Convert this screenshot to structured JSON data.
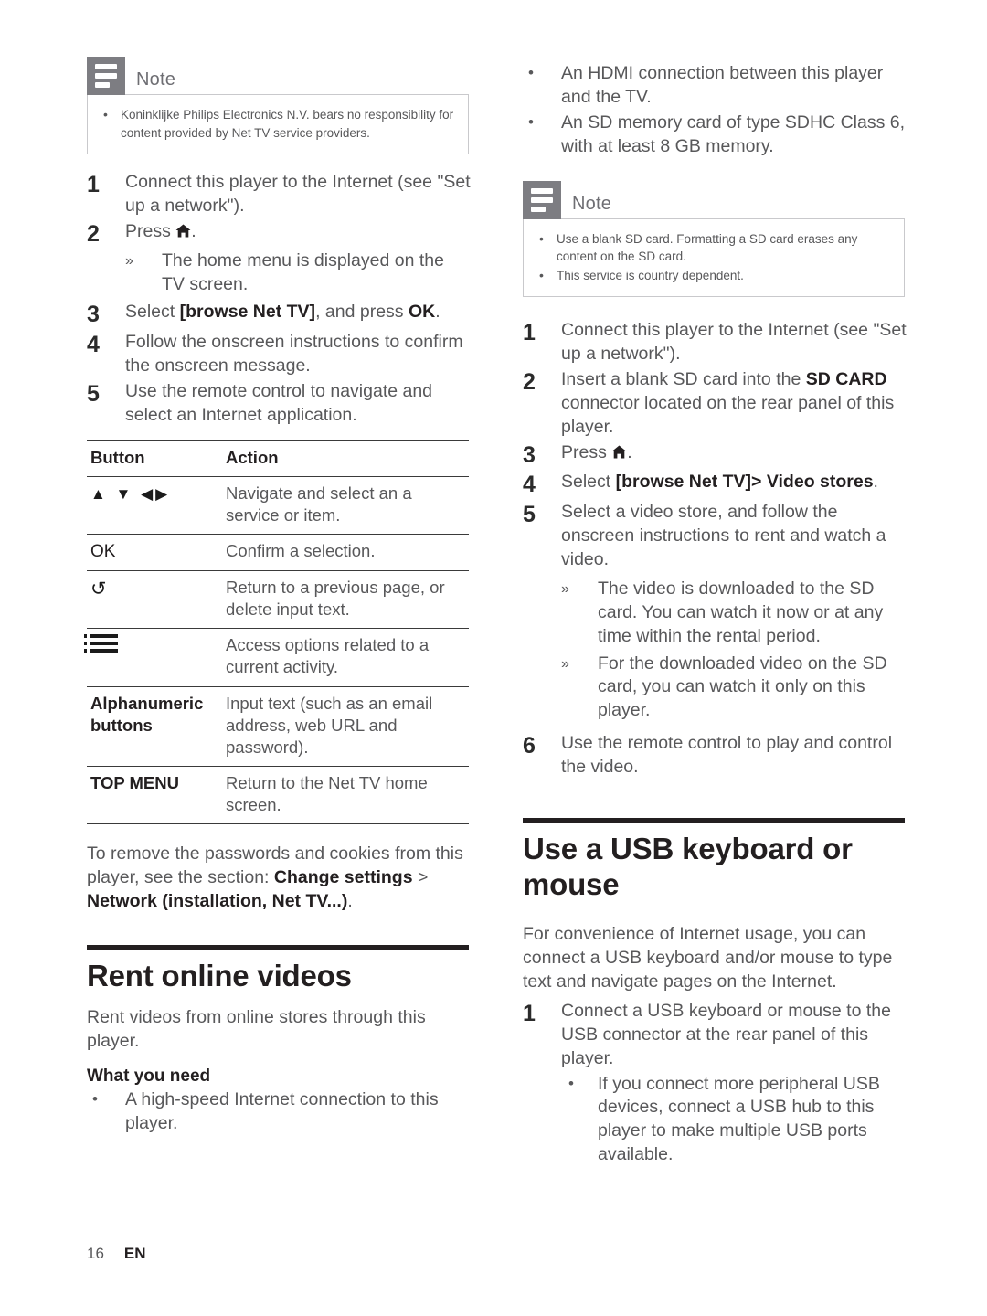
{
  "page": {
    "number": "16",
    "language": "EN"
  },
  "colors": {
    "note_icon_bg": "#7d7d82",
    "note_border": "#c9c9cc",
    "heading": "#231f20",
    "body_text": "#58585a"
  },
  "left_column": {
    "note": {
      "icon_name": "note-icon",
      "title": "Note",
      "items": [
        "Koninklijke Philips Electronics N.V. bears no responsibility for content provided by Net TV service providers."
      ]
    },
    "steps": [
      {
        "num": "1",
        "text": "Connect this player to the Internet (see \"Set up a network\")."
      },
      {
        "num": "2",
        "text": "Press ⌂.",
        "text_plain": "Press .",
        "subs": [
          "The home menu is displayed on the TV screen."
        ]
      },
      {
        "num": "3",
        "text": "Select [browse Net TV], and press OK."
      },
      {
        "num": "4",
        "text": "Follow the onscreen instructions to confirm the onscreen message."
      },
      {
        "num": "5",
        "text": "Use the remote control to navigate and select an Internet application."
      }
    ],
    "table": {
      "headers": [
        "Button",
        "Action"
      ],
      "rows": [
        {
          "button": "▲ ▼ ◀▶",
          "button_kind": "arrows",
          "action": "Navigate and select an a service or item."
        },
        {
          "button": "OK",
          "button_kind": "text",
          "action": "Confirm a selection."
        },
        {
          "button": "↺",
          "button_kind": "return",
          "action": "Return to a previous page, or delete input text."
        },
        {
          "button": "options-list-icon",
          "button_kind": "icon",
          "action": "Access options related to a current activity."
        },
        {
          "button": "Alphanumeric buttons",
          "button_kind": "bold",
          "action": "Input text (such as an email address, web URL and password)."
        },
        {
          "button": "TOP MENU",
          "button_kind": "bold",
          "action": "Return to the Net TV home screen."
        }
      ]
    },
    "closing_paragraph": {
      "lead": "To remove the passwords and cookies from this player, see the section: ",
      "bold1": "Change settings",
      "mid": " > ",
      "bold2": "Network (installation, Net TV...)",
      "tail": "."
    },
    "section": {
      "title": "Rent online videos",
      "intro": "Rent videos from online stores through this player.",
      "subhead": "What you need",
      "bullets": [
        "A high-speed Internet connection to this player."
      ]
    }
  },
  "right_column": {
    "top_bullets": [
      "An HDMI connection between this player and the TV.",
      "An SD memory card of type SDHC Class 6, with at least 8 GB memory."
    ],
    "note": {
      "icon_name": "note-icon",
      "title": "Note",
      "items": [
        "Use a blank SD card. Formatting a SD card erases any content on the SD card.",
        "This service is country dependent."
      ]
    },
    "steps": [
      {
        "num": "1",
        "text": "Connect this player to the Internet (see \"Set up a network\")."
      },
      {
        "num": "2",
        "lead": "Insert a blank SD card into the ",
        "bold": "SD CARD",
        "tail": " connector located on the rear panel of this player."
      },
      {
        "num": "3",
        "text": "Press ⌂."
      },
      {
        "num": "4",
        "lead": "Select ",
        "bold": "[browse Net TV]> Video stores",
        "tail": "."
      },
      {
        "num": "5",
        "text": "Select a video store, and follow the onscreen instructions to rent and watch a video.",
        "subs": [
          "The video is downloaded to the SD card. You can watch it now or at any time within the rental period.",
          "For the downloaded video on the SD card, you can watch it only on this player."
        ]
      },
      {
        "num": "6",
        "text": "Use the remote control to play and control the video."
      }
    ],
    "section": {
      "title": "Use a USB keyboard or mouse",
      "intro": "For convenience of Internet usage, you can connect a USB keyboard and/or mouse to type text and navigate pages on the Internet.",
      "steps": [
        {
          "num": "1",
          "text": "Connect a USB keyboard or mouse to the USB connector at the rear panel of this player.",
          "bullets": [
            "If you connect more peripheral USB devices, connect a USB hub to this player to make multiple USB ports available."
          ]
        }
      ]
    }
  }
}
